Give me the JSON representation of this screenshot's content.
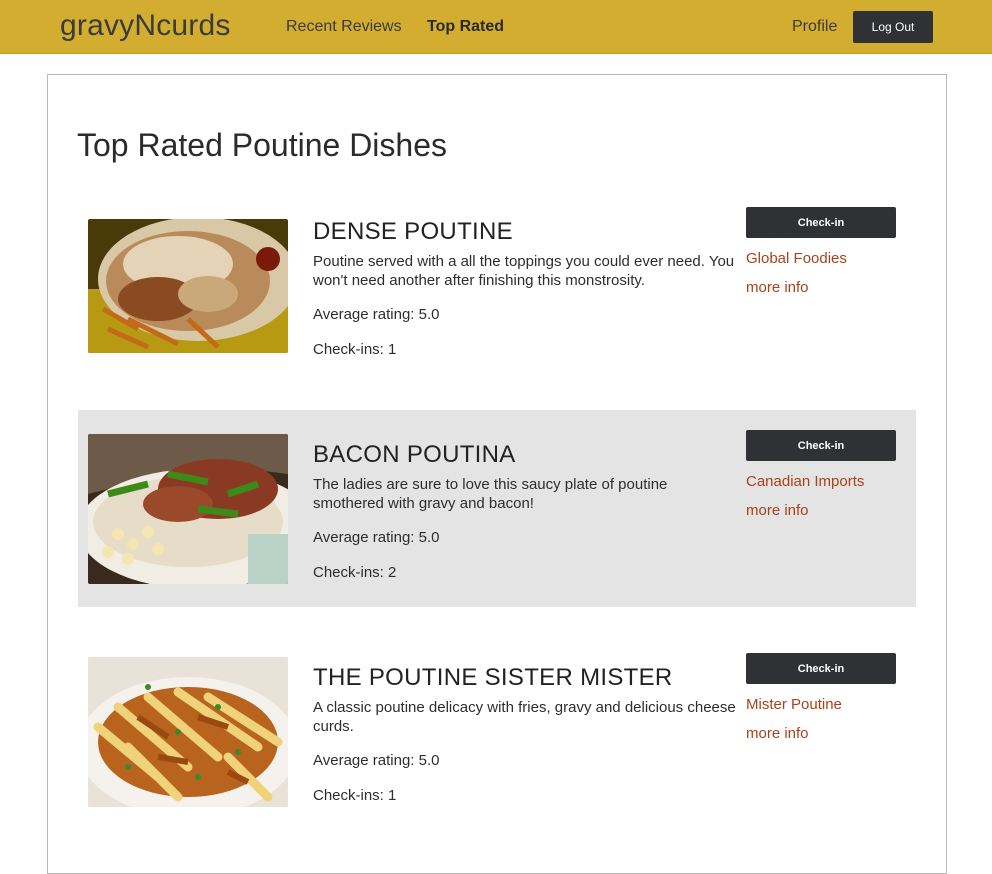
{
  "header": {
    "brand": "gravyNcurds",
    "nav": [
      {
        "label": "Recent Reviews",
        "active": false
      },
      {
        "label": "Top Rated",
        "active": true
      }
    ],
    "profile_label": "Profile",
    "logout_label": "Log Out",
    "bar_color": "#d2ad2f"
  },
  "main": {
    "title": "Top Rated Poutine Dishes",
    "dishes": [
      {
        "name": "DENSE POUTINE",
        "description": "Poutine served with a all the toppings you could ever need. You won't need another after finishing this monstrosity.",
        "rating_text": "Average rating: 5.0",
        "checkins_text": "Check-ins: 1",
        "checkin_label": "Check-in",
        "vendor": "Global Foodies",
        "info_label": "more info",
        "image_icon": "poutine-photo"
      },
      {
        "name": "BACON POUTINA",
        "description": "The ladies are sure to love this saucy plate of poutine smothered with gravy and bacon!",
        "rating_text": "Average rating: 5.0",
        "checkins_text": "Check-ins: 2",
        "checkin_label": "Check-in",
        "vendor": "Canadian Imports",
        "info_label": "more info",
        "image_icon": "poutine-photo"
      },
      {
        "name": "THE POUTINE SISTER MISTER",
        "description": "A classic poutine delicacy with fries, gravy and delicious cheese curds.",
        "rating_text": "Average rating: 5.0",
        "checkins_text": "Check-ins: 1",
        "checkin_label": "Check-in",
        "vendor": "Mister Poutine",
        "info_label": "more info",
        "image_icon": "poutine-photo"
      }
    ],
    "link_color": "#a8421c",
    "button_color": "#2f3135",
    "row_highlight_color": "#e4e4e4"
  }
}
